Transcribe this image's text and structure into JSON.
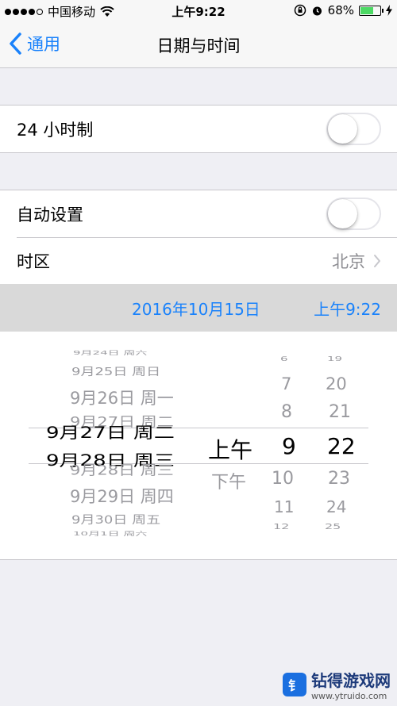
{
  "status_bar": {
    "carrier": "中国移动",
    "time": "上午9:22",
    "battery": "68%",
    "battery_level": 0.68
  },
  "nav": {
    "back_label": "通用",
    "title": "日期与时间"
  },
  "settings": {
    "hour24_label": "24 小时制",
    "hour24_on": false,
    "auto_label": "自动设置",
    "auto_on": false,
    "timezone_label": "时区",
    "timezone_value": "北京"
  },
  "datetime": {
    "date": "2016年10月15日",
    "time": "上午9:22"
  },
  "picker": {
    "date_items": [
      "9月24日 周六",
      "9月25日 周日",
      "9月26日 周一",
      "9月27日 周二",
      "9月28日 周三",
      "9月29日 周四",
      "9月30日 周五",
      "10月1日 周六"
    ],
    "selected_date_upper": "9月27日 周二",
    "selected_date_lower": "9月28日 周三",
    "ampm_items": [
      "上午",
      "下午"
    ],
    "hour_items": [
      "6",
      "7",
      "8",
      "9",
      "10",
      "11",
      "12"
    ],
    "minute_items": [
      "19",
      "20",
      "21",
      "22",
      "23",
      "24",
      "25"
    ]
  },
  "watermark": {
    "logo": "钅",
    "title": "钻得游戏网",
    "url": "www.ytruido.com"
  }
}
